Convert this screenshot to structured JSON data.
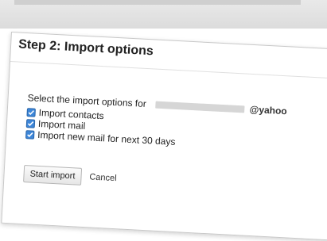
{
  "dialog": {
    "title": "Step 2: Import options",
    "prompt": "Select the import options for",
    "email_domain": "@yahoo",
    "options": [
      {
        "label": "Import contacts",
        "checked": true
      },
      {
        "label": "Import mail",
        "checked": true
      },
      {
        "label": "Import new mail for next 30 days",
        "checked": true
      }
    ],
    "start_button": "Start import",
    "cancel_button": "Cancel"
  },
  "colors": {
    "checkbox": "#3d86d8",
    "text": "#222222"
  }
}
